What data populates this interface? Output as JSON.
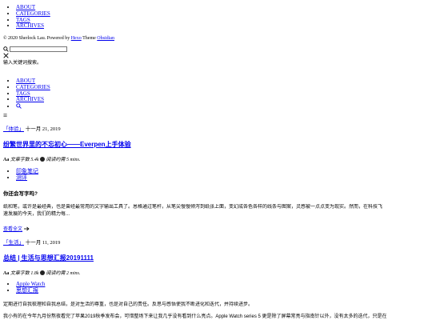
{
  "top_nav": {
    "items": [
      "ABOUT",
      "CATEGORIES",
      "TAGS",
      "ARCHIVES"
    ]
  },
  "footer": {
    "prefix": "© 2020 Sherlock Lau. Powered by",
    "hexo": "Hexo",
    "theme_word": "Theme",
    "obsidian": "Obsidian"
  },
  "search": {
    "placeholder": "",
    "hint": "输入关键词搜索。"
  },
  "menu_nav": {
    "items": [
      "ABOUT",
      "CATEGORIES",
      "TAGS",
      "ARCHIVES"
    ]
  },
  "hamburger_glyph": "≡",
  "posts": [
    {
      "category": "「体验」",
      "date": "十一月 21, 2019",
      "title": "纷繁世界里的不忘初心——Everpen上手体验",
      "meta_aa": "Aa",
      "word_label": "文章字数",
      "word_count": "5.4k",
      "read_label": "阅读约需",
      "read_time": "5 mins.",
      "tags": [
        "印象笔记",
        "测评"
      ],
      "heading": "你还会写字吗?",
      "excerpt_lines": [
        "纸和笔，或许是最经典，也是曾经最常用的文字输出工具了。恩格通过笔杆，从笔尖慢慢倾泻到纸张上面，变幻成各色各样的线条与图案，灵感被一点点变为现实。然而，在科技飞",
        "速发展的今天，我们的精力每..."
      ],
      "read_more": "查看全文"
    },
    {
      "category": "「生活」",
      "date": "十一月 11, 2019",
      "title": "总结 | 生活与思想汇报20191111",
      "meta_aa": "Aa",
      "word_label": "文章字数",
      "word_count": "1.8k",
      "read_label": "阅读约需",
      "read_time": "2 mins.",
      "tags": [
        "Apple Watch",
        "思想汇报"
      ],
      "excerpt_lines": [
        "定期进行自我梳理和自我总结，是对生活的尊重，也是对自己的责任。反思与感悟使我不断进化和迭代，并持续进步。",
        "我小有的在今年九月份熬夜看完了苹果2019秋季发布会，可惜整场下来让我几乎没有看到什么亮点。Apple Watch series 5 更是除了屏幕常亮与指南针以外，没有太多的迭代，只是在"
      ]
    }
  ]
}
